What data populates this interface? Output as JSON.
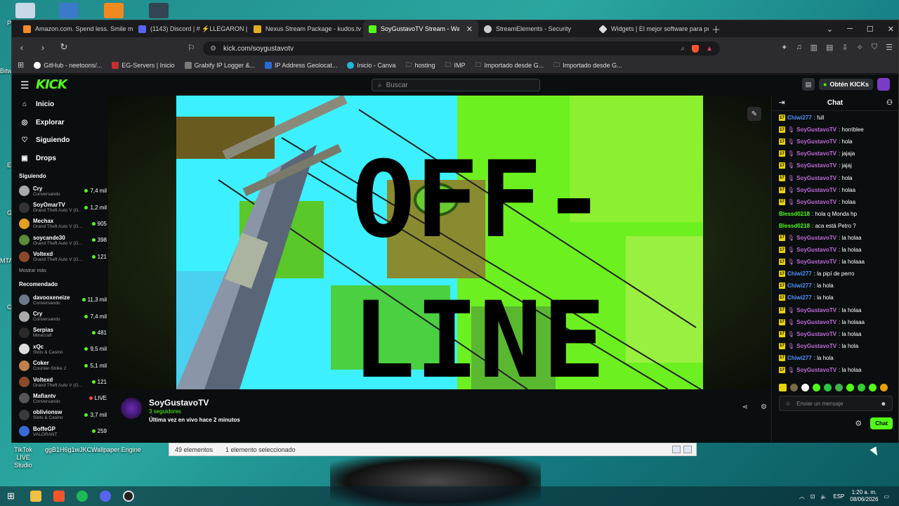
{
  "desktop": {
    "icons_bottom": [
      {
        "label": "TikTok LIVE Studio"
      },
      {
        "label": "ggB1H6g1wJKC..."
      },
      {
        "label": "Wallpaper Engine"
      }
    ],
    "left_edge_labels": [
      "P",
      "Bitw",
      "E",
      "G",
      "MTA",
      "C"
    ]
  },
  "browser": {
    "tabs": [
      {
        "label": "Amazon.com. Spend less. Smile more",
        "color": "#f28c28"
      },
      {
        "label": "(1143) Discord | # ⚡LLEGARON | Stre",
        "color": "#5865f2"
      },
      {
        "label": "Nexus Stream Package - kudos.tv He",
        "color": "#e0b020"
      },
      {
        "label": "SoyGustavoTV Stream - Watch Live",
        "color": "#53fc18"
      },
      {
        "label": "StreamElements - Security",
        "color": "#cccccc"
      },
      {
        "label": "Widgets | El mejor software para poten",
        "color": "#dddddd"
      }
    ],
    "active_tab_index": 3,
    "url": "kick.com/soygustavotv",
    "bookmarks": [
      {
        "label": "GitHub - neetoons/...",
        "color": "#ffffff"
      },
      {
        "label": "EG-Servers | Inicio",
        "color": "#c03030"
      },
      {
        "label": "Grabify IP Logger &...",
        "color": "#7a7a7a"
      },
      {
        "label": "IP Address Geolocat...",
        "color": "#2a6ad8"
      },
      {
        "label": "Inicio - Canva",
        "color": "#20b8d8"
      },
      {
        "label": "hosting",
        "color": "folder"
      },
      {
        "label": "IMP",
        "color": "folder"
      },
      {
        "label": "Importado desde G...",
        "color": "folder"
      },
      {
        "label": "Importado desde G...",
        "color": "folder"
      }
    ]
  },
  "kick": {
    "logo": "KICK",
    "search_placeholder": "Buscar",
    "kicks_label": "Obtén KICKs",
    "nav": [
      {
        "label": "Inicio",
        "icon": "home-icon",
        "glyph": "⌂"
      },
      {
        "label": "Explorar",
        "icon": "compass-icon",
        "glyph": "◎"
      },
      {
        "label": "Siguiendo",
        "icon": "heart-icon",
        "glyph": "♡"
      },
      {
        "label": "Drops",
        "icon": "gift-icon",
        "glyph": "▣"
      }
    ],
    "following_title": "Siguiendo",
    "following": [
      {
        "name": "Cry",
        "game": "Conversando",
        "viewers": "7,4 mil",
        "color": "#aaaaaa"
      },
      {
        "name": "SoyOmarTV",
        "game": "Grand Theft Auto V (G...",
        "viewers": "1,2 mil",
        "color": "#333333"
      },
      {
        "name": "Mechax",
        "game": "Grand Theft Auto V (G...",
        "viewers": "905",
        "color": "#e0a020"
      },
      {
        "name": "soycande30",
        "game": "Grand Theft Auto V (G...",
        "viewers": "398",
        "color": "#5a8a3a"
      },
      {
        "name": "Voltexd",
        "game": "Grand Theft Auto V (G...",
        "viewers": "121",
        "color": "#8a4a2a"
      }
    ],
    "show_more": "Mostrar más",
    "recommended_title": "Recomendado",
    "recommended": [
      {
        "name": "davooxeneize",
        "game": "Conversando",
        "viewers": "11,3 mil",
        "color": "#6a7a8a"
      },
      {
        "name": "Cry",
        "game": "Conversando",
        "viewers": "7,4 mil",
        "color": "#aaaaaa"
      },
      {
        "name": "Serpias",
        "game": "Minecraft",
        "viewers": "481",
        "color": "#2a2a2a"
      },
      {
        "name": "xQc",
        "game": "Slots & Casino",
        "viewers": "9,5 mil",
        "color": "#dddddd"
      },
      {
        "name": "Coker",
        "game": "Counter-Strike 2",
        "viewers": "5,1 mil",
        "color": "#c08050"
      },
      {
        "name": "Voltexd",
        "game": "Grand Theft Auto V (G...",
        "viewers": "121",
        "color": "#8a4a2a"
      },
      {
        "name": "Mafiantv",
        "game": "Conversando",
        "viewers": "LIVE",
        "color": "#555555"
      },
      {
        "name": "oblivionsw",
        "game": "Slots & Casino",
        "viewers": "3,7 mil",
        "color": "#3a3a3a"
      },
      {
        "name": "BoffeGP",
        "game": "VALORANT",
        "viewers": "259",
        "color": "#3a6ad8"
      }
    ],
    "offline_text": {
      "line1": "OFF-",
      "line2": "LINE"
    },
    "streamer": {
      "name": "SoyGustavoTV",
      "followers": "3 seguidores",
      "last_live": "Última vez en vivo hace 2 minutos"
    },
    "chat": {
      "title": "Chat",
      "input_placeholder": "Enviar un mensaje",
      "send_label": "Chat",
      "messages": [
        {
          "user": "Chiwi277",
          "text": ": full",
          "badge": false,
          "color": "#4a90ff"
        },
        {
          "user": "SoyGustavoTV",
          "text": ": horriblee",
          "badge": true,
          "color": "#c06ad8"
        },
        {
          "user": "SoyGustavoTV",
          "text": ": hola",
          "badge": true,
          "color": "#c06ad8"
        },
        {
          "user": "SoyGustavoTV",
          "text": ": jajaja",
          "badge": true,
          "color": "#c06ad8"
        },
        {
          "user": "SoyGustavoTV",
          "text": ": jajaj",
          "badge": true,
          "color": "#c06ad8"
        },
        {
          "user": "SoyGustavoTV",
          "text": ": hola",
          "badge": true,
          "color": "#c06ad8"
        },
        {
          "user": "SoyGustavoTV",
          "text": ": holaa",
          "badge": true,
          "color": "#c06ad8"
        },
        {
          "user": "SoyGustavoTV",
          "text": ": holaa",
          "badge": true,
          "color": "#c06ad8"
        },
        {
          "user": "Blessd0218",
          "text": ": hola q Monda hp",
          "badge": false,
          "color": "#53fc18"
        },
        {
          "user": "Blessd0218",
          "text": ": aca está Petro ?",
          "badge": false,
          "color": "#53fc18"
        },
        {
          "user": "SoyGustavoTV",
          "text": ": la holaa",
          "badge": true,
          "color": "#c06ad8"
        },
        {
          "user": "SoyGustavoTV",
          "text": ": la holaa",
          "badge": true,
          "color": "#c06ad8"
        },
        {
          "user": "SoyGustavoTV",
          "text": ": la holaaa",
          "badge": true,
          "color": "#c06ad8"
        },
        {
          "user": "Chiwi277",
          "text": ": la pipí de perro",
          "badge": false,
          "color": "#4a90ff"
        },
        {
          "user": "Chiwi277",
          "text": ": la hola",
          "badge": false,
          "color": "#4a90ff"
        },
        {
          "user": "Chiwi277",
          "text": ": la hola",
          "badge": false,
          "color": "#4a90ff"
        },
        {
          "user": "SoyGustavoTV",
          "text": ": la holaa",
          "badge": true,
          "color": "#c06ad8"
        },
        {
          "user": "SoyGustavoTV",
          "text": ": la holaaa",
          "badge": true,
          "color": "#c06ad8"
        },
        {
          "user": "SoyGustavoTV",
          "text": ": la holaa",
          "badge": true,
          "color": "#c06ad8"
        },
        {
          "user": "SoyGustavoTV",
          "text": ": la hola",
          "badge": true,
          "color": "#c06ad8"
        },
        {
          "user": "Chiwi277",
          "text": ": la hola",
          "badge": false,
          "color": "#4a90ff"
        },
        {
          "user": "SoyGustavoTV",
          "text": ": la holaa",
          "badge": true,
          "color": "#c06ad8"
        },
        {
          "user": "Chiwi277",
          "text": ": la hola",
          "badge": false,
          "color": "#4a90ff"
        }
      ]
    }
  },
  "explorer": {
    "count": "49 elementos",
    "selected": "1 elemento seleccionado"
  },
  "taskbar": {
    "lang": "ESP",
    "time": "1:20 a. m.",
    "date": "08/06/2026"
  },
  "colors": {
    "kick_green": "#53fc18"
  }
}
